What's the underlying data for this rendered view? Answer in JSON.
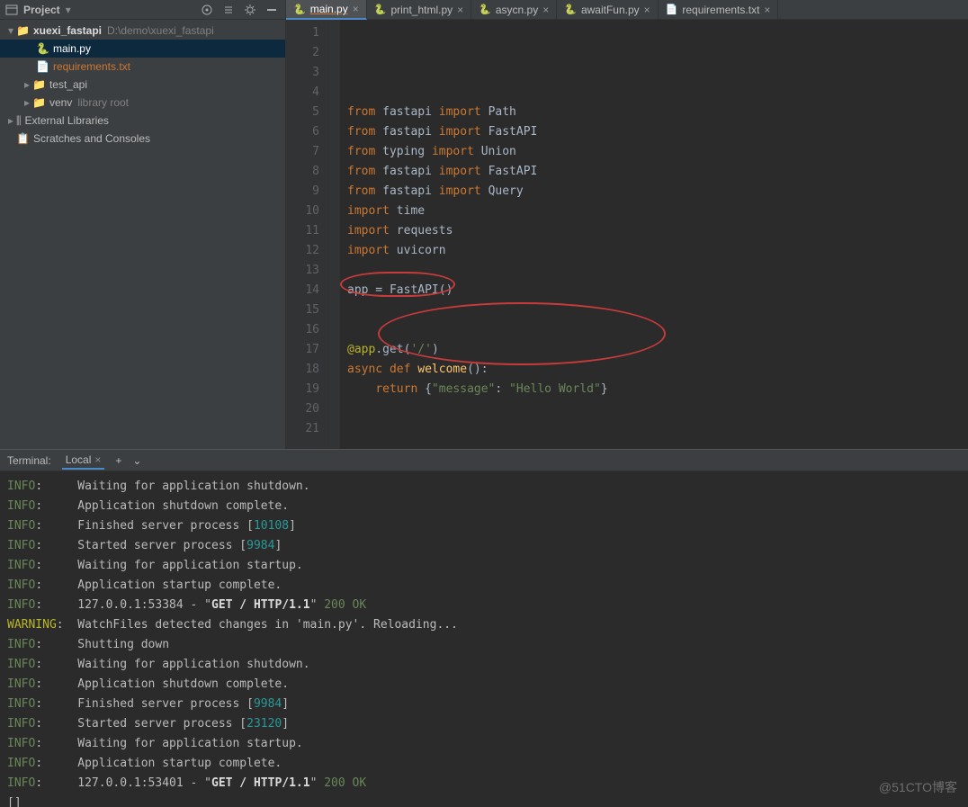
{
  "project": {
    "title": "Project",
    "toolbarIcons": [
      "target",
      "sort",
      "gear",
      "minimize"
    ],
    "tree": {
      "root": {
        "name": "xuexi_fastapi",
        "path": "D:\\demo\\xuexi_fastapi"
      },
      "files": [
        {
          "name": "main.py",
          "kind": "py",
          "selected": true
        },
        {
          "name": "requirements.txt",
          "kind": "txt"
        }
      ],
      "folders": [
        {
          "name": "test_api"
        },
        {
          "name": "venv",
          "hint": "library root"
        }
      ],
      "extLibs": "External Libraries",
      "scratches": "Scratches and Consoles"
    }
  },
  "tabs": [
    {
      "name": "main.py",
      "active": true,
      "underline": true
    },
    {
      "name": "print_html.py"
    },
    {
      "name": "asycn.py"
    },
    {
      "name": "awaitFun.py"
    },
    {
      "name": "requirements.txt",
      "kind": "txt"
    }
  ],
  "code": {
    "lines": [
      [
        [
          "kw",
          "from "
        ],
        [
          "id",
          "fastapi "
        ],
        [
          "kw",
          "import "
        ],
        [
          "id",
          "Path"
        ]
      ],
      [
        [
          "kw",
          "from "
        ],
        [
          "id",
          "fastapi "
        ],
        [
          "kw",
          "import "
        ],
        [
          "id",
          "FastAPI"
        ]
      ],
      [
        [
          "kw",
          "from "
        ],
        [
          "id",
          "typing "
        ],
        [
          "kw",
          "import "
        ],
        [
          "id",
          "Union"
        ]
      ],
      [
        [
          "kw",
          "from "
        ],
        [
          "id",
          "fastapi "
        ],
        [
          "kw",
          "import "
        ],
        [
          "id",
          "FastAPI"
        ]
      ],
      [
        [
          "kw",
          "from "
        ],
        [
          "id",
          "fastapi "
        ],
        [
          "kw",
          "import "
        ],
        [
          "id",
          "Query"
        ]
      ],
      [
        [
          "kw",
          "import "
        ],
        [
          "id",
          "time"
        ]
      ],
      [
        [
          "kw",
          "import "
        ],
        [
          "id",
          "requests"
        ]
      ],
      [
        [
          "kw",
          "import "
        ],
        [
          "id",
          "uvicorn"
        ]
      ],
      [],
      [
        [
          "id",
          "app = FastAPI()"
        ]
      ],
      [],
      [],
      [
        [
          "dec",
          "@app"
        ],
        [
          "id",
          ".get("
        ],
        [
          "str",
          "'/'"
        ],
        [
          "id",
          ")"
        ]
      ],
      [
        [
          "kw",
          "async def "
        ],
        [
          "fn",
          "welcome"
        ],
        [
          "id",
          "():"
        ]
      ],
      [
        [
          "id",
          "    "
        ],
        [
          "kw",
          "return "
        ],
        [
          "id",
          "{"
        ],
        [
          "str",
          "\"message\""
        ],
        [
          "id",
          ": "
        ],
        [
          "str",
          "\"Hello World\""
        ],
        [
          "id",
          "}"
        ]
      ],
      [],
      [],
      [],
      [],
      [],
      []
    ]
  },
  "terminal": {
    "title": "Terminal:",
    "tabName": "Local",
    "lines": [
      {
        "lvl": "INFO",
        "text": "Waiting for application shutdown."
      },
      {
        "lvl": "INFO",
        "text": "Application shutdown complete."
      },
      {
        "lvl": "INFO",
        "pre": "Finished server process [",
        "num": "10108",
        "post": "]"
      },
      {
        "lvl": "INFO",
        "pre": "Started server process [",
        "num": "9984",
        "post": "]"
      },
      {
        "lvl": "INFO",
        "text": "Waiting for application startup."
      },
      {
        "lvl": "INFO",
        "text": "Application startup complete."
      },
      {
        "lvl": "INFO",
        "pre": "127.0.0.1:53384 - \"",
        "http": "GET / HTTP/1.1",
        "post": "\" ",
        "ok": "200 OK"
      },
      {
        "lvl": "WARNING",
        "text": "WatchFiles detected changes in 'main.py'. Reloading..."
      },
      {
        "lvl": "INFO",
        "text": "Shutting down"
      },
      {
        "lvl": "INFO",
        "text": "Waiting for application shutdown."
      },
      {
        "lvl": "INFO",
        "text": "Application shutdown complete."
      },
      {
        "lvl": "INFO",
        "pre": "Finished server process [",
        "num": "9984",
        "post": "]"
      },
      {
        "lvl": "INFO",
        "pre": "Started server process [",
        "num": "23120",
        "post": "]"
      },
      {
        "lvl": "INFO",
        "text": "Waiting for application startup."
      },
      {
        "lvl": "INFO",
        "text": "Application startup complete."
      },
      {
        "lvl": "INFO",
        "pre": "127.0.0.1:53401 - \"",
        "http": "GET / HTTP/1.1",
        "post": "\" ",
        "ok": "200 OK"
      }
    ],
    "prompt": "[]"
  },
  "watermark": "@51CTO博客"
}
